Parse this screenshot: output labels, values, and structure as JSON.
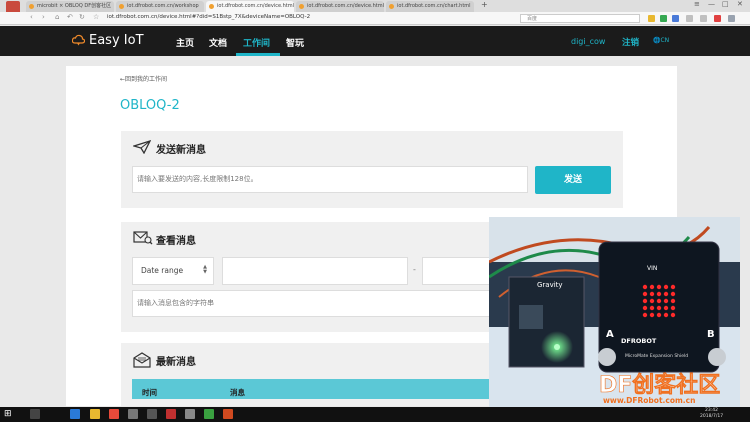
{
  "browser": {
    "tabs": [
      {
        "label": "microbit × OBLOQ DF创客社区"
      },
      {
        "label": "iot.dfrobot.com.cn/workshop"
      },
      {
        "label": "iot.dfrobot.com.cn/device.html"
      },
      {
        "label": "iot.dfrobot.com.cn/device.html"
      },
      {
        "label": "iot.dfrobot.com.cn/chart.html"
      }
    ],
    "new_tab": "+",
    "url": "iot.dfrobot.com.cn/device.html#?did=S1Bstp_7X&deviceName=OBLOQ-2",
    "search_placeholder": "百度"
  },
  "header": {
    "logo_text": "Easy IoT",
    "nav": [
      "主页",
      "文档",
      "工作间",
      "智玩"
    ],
    "active_nav": "工作间",
    "username": "digi_cow",
    "logout": "注销",
    "language": "CN"
  },
  "page": {
    "back_link": "←回到我的工作间",
    "device_title": "OBLOQ-2",
    "send_panel": {
      "title": "发送新消息",
      "input_placeholder": "请输入要发送的内容,长度限制128位。",
      "send_button": "发送"
    },
    "view_panel": {
      "title": "查看消息",
      "date_range": "Date range",
      "separator": "-",
      "filter_placeholder": "请输入消息包含的字符串"
    },
    "latest_panel": {
      "title": "最新消息",
      "columns": [
        "时间",
        "消息"
      ]
    }
  },
  "overlay": {
    "watermark_brand": "DF创客社区",
    "watermark_url": "www.DFRobot.com.cn",
    "board_labels": [
      "Gravity",
      "DFROBOT",
      "MicroMate Expansion Shield",
      "A",
      "B",
      "VIN"
    ]
  },
  "taskbar": {
    "time": "23:42",
    "date": "2018/7/17"
  },
  "colors": {
    "accent": "#1fb5c8",
    "header_bg": "#1b1b1b",
    "panel_bg": "#f0f0f0"
  }
}
